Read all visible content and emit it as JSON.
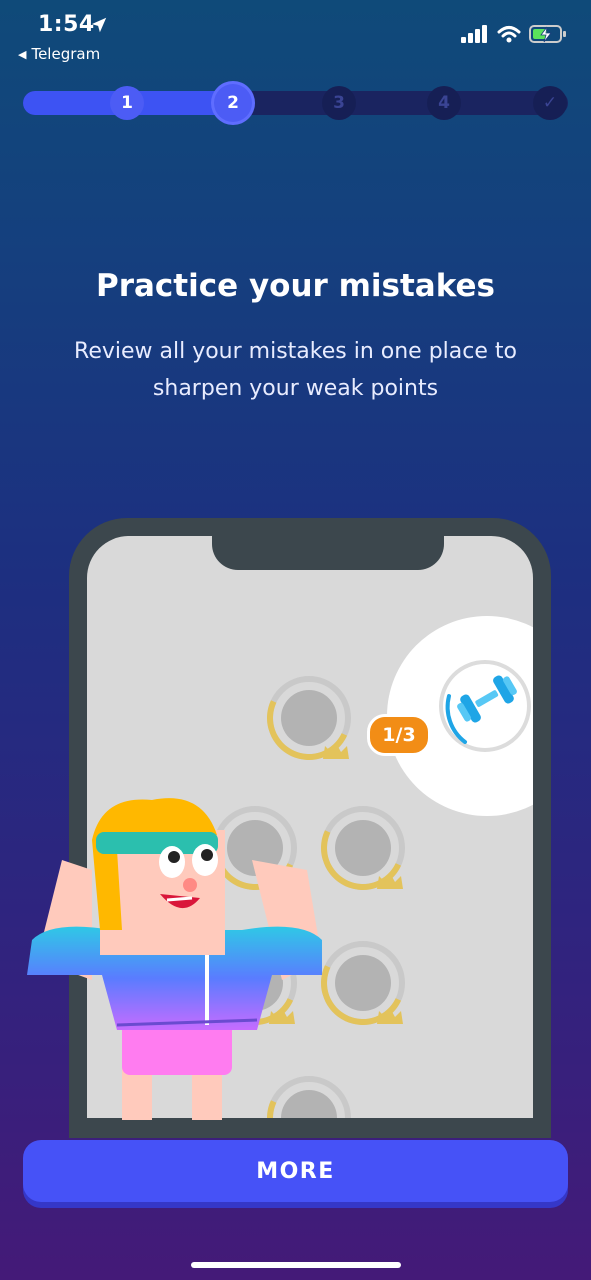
{
  "status_bar": {
    "time": "1:54",
    "back_app": "Telegram"
  },
  "progress": {
    "steps": [
      {
        "label": "1",
        "state": "done"
      },
      {
        "label": "2",
        "state": "current"
      },
      {
        "label": "3",
        "state": "todo"
      },
      {
        "label": "4",
        "state": "todo"
      },
      {
        "label": "✓",
        "state": "todo"
      }
    ],
    "current_step": 2,
    "total_steps": 5
  },
  "content": {
    "title": "Practice your mistakes",
    "subtitle": "Review all your mistakes in one place to sharpen your weak points"
  },
  "illustration": {
    "practice_badge": "1/3",
    "icons": [
      "dumbbell-icon",
      "crown-icon"
    ]
  },
  "actions": {
    "more_label": "MORE"
  },
  "colors": {
    "button": "#4652f7",
    "progress_fill": "#3d53f3",
    "badge": "#f28d16",
    "crown": "#e3c35b"
  }
}
